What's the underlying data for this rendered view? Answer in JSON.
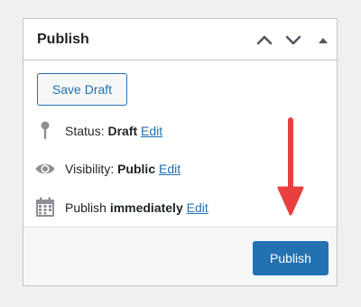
{
  "colors": {
    "accent": "#2271b1",
    "annotation_arrow": "#e8403f"
  },
  "box": {
    "title": "Publish",
    "header_icons": [
      "chevron-up-icon",
      "chevron-down-icon",
      "triangle-up-icon"
    ]
  },
  "minor_actions": {
    "save_draft_label": "Save Draft"
  },
  "misc": {
    "status": {
      "icon": "pin-icon",
      "label": "Status:",
      "value": "Draft",
      "edit": "Edit"
    },
    "visibility": {
      "icon": "eye-icon",
      "label": "Visibility:",
      "value": "Public",
      "edit": "Edit"
    },
    "publish_time": {
      "icon": "calendar-icon",
      "label": "Publish",
      "value": "immediately",
      "edit": "Edit"
    }
  },
  "major_actions": {
    "publish_label": "Publish"
  },
  "annotation": {
    "icon": "red-down-arrow-icon"
  }
}
